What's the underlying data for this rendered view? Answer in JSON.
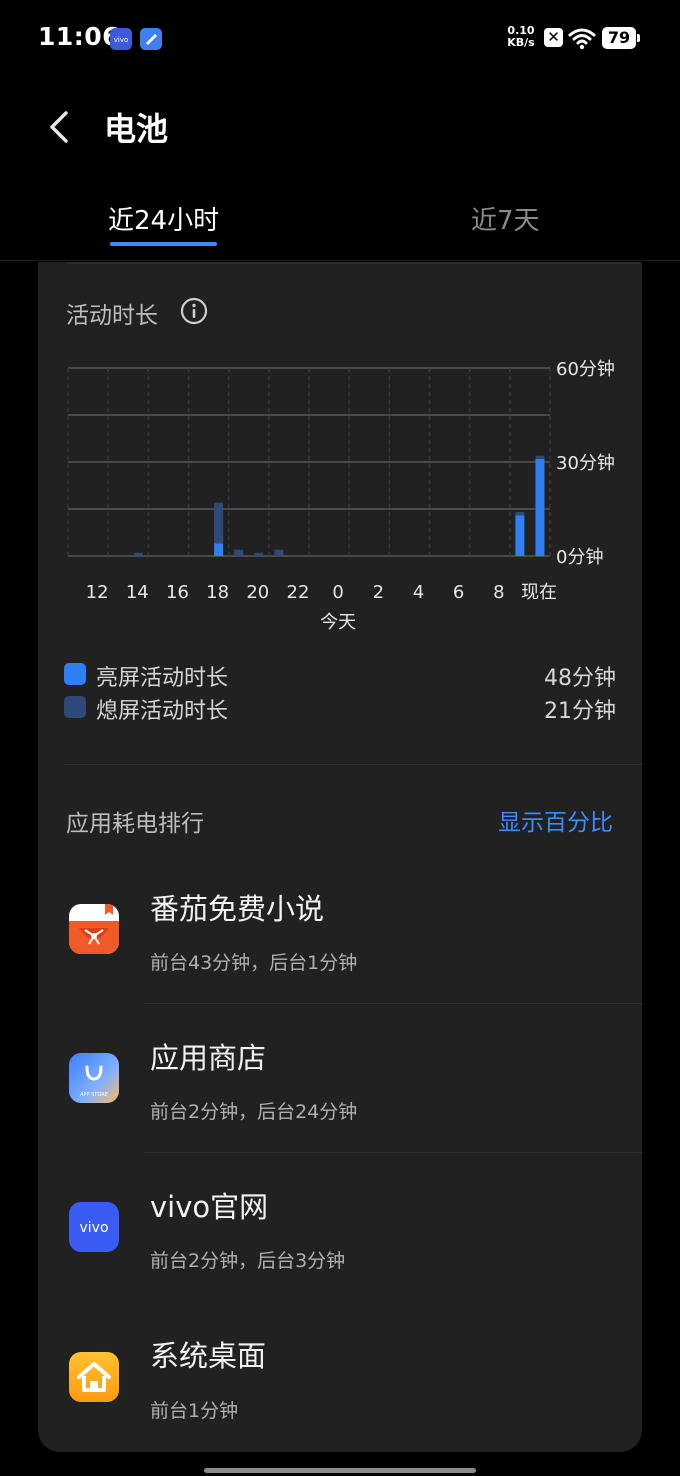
{
  "status_bar": {
    "time": "11:06",
    "net_speed_value": "0.10",
    "net_speed_unit": "KB/s",
    "battery": "79",
    "icons": [
      "vivo-app-icon",
      "blue-app-icon",
      "x-icon",
      "wifi-icon",
      "battery-icon"
    ]
  },
  "header": {
    "title": "电池",
    "back_icon": "chevron-left-icon"
  },
  "tabs": [
    {
      "label": "近24小时",
      "active": true
    },
    {
      "label": "近7天",
      "active": false
    }
  ],
  "activity": {
    "title": "活动时长",
    "info_icon": "info-icon",
    "legend": [
      {
        "label": "亮屏活动时长",
        "value": "48分钟",
        "color": "#2f80f5"
      },
      {
        "label": "熄屏活动时长",
        "value": "21分钟",
        "color": "#2e4a7a"
      }
    ]
  },
  "chart_data": {
    "type": "bar",
    "stacked": true,
    "x": [
      "11",
      "12",
      "13",
      "14",
      "15",
      "16",
      "17",
      "18",
      "19",
      "20",
      "21",
      "22",
      "23",
      "0",
      "1",
      "2",
      "3",
      "4",
      "5",
      "6",
      "7",
      "8",
      "9",
      "10"
    ],
    "x_tick_labels": [
      "12",
      "14",
      "16",
      "18",
      "20",
      "22",
      "0",
      "2",
      "4",
      "6",
      "8",
      "现在"
    ],
    "x_sublabel": "今天",
    "y_tick_labels": [
      "60分钟",
      "30分钟",
      "0分钟"
    ],
    "ylim": [
      0,
      60
    ],
    "grid": true,
    "series": [
      {
        "name": "亮屏活动时长",
        "color": "#2f80f5",
        "values": [
          0,
          0,
          0,
          0,
          0,
          0,
          0,
          4,
          0,
          0,
          0,
          0,
          0,
          0,
          0,
          0,
          0,
          0,
          0,
          0,
          0,
          0,
          13,
          31
        ]
      },
      {
        "name": "熄屏活动时长",
        "color": "#2e4a7a",
        "values": [
          0,
          0,
          0,
          1,
          0,
          0,
          0,
          13,
          2,
          1,
          2,
          0,
          0,
          0,
          0,
          0,
          0,
          0,
          0,
          0,
          0,
          0,
          1,
          1
        ]
      }
    ]
  },
  "ranking": {
    "title": "应用耗电排行",
    "toggle_label": "显示百分比",
    "apps": [
      {
        "name": "番茄免费小说",
        "detail": "前台43分钟，后台1分钟",
        "icon": "tomato-novel-icon"
      },
      {
        "name": "应用商店",
        "detail": "前台2分钟，后台24分钟",
        "icon": "app-store-icon",
        "icon_text": "APP STORE"
      },
      {
        "name": "vivo官网",
        "detail": "前台2分钟，后台3分钟",
        "icon": "vivo-official-icon",
        "icon_text": "vivo"
      },
      {
        "name": "系统桌面",
        "detail": "前台1分钟",
        "icon": "home-launcher-icon"
      }
    ]
  }
}
